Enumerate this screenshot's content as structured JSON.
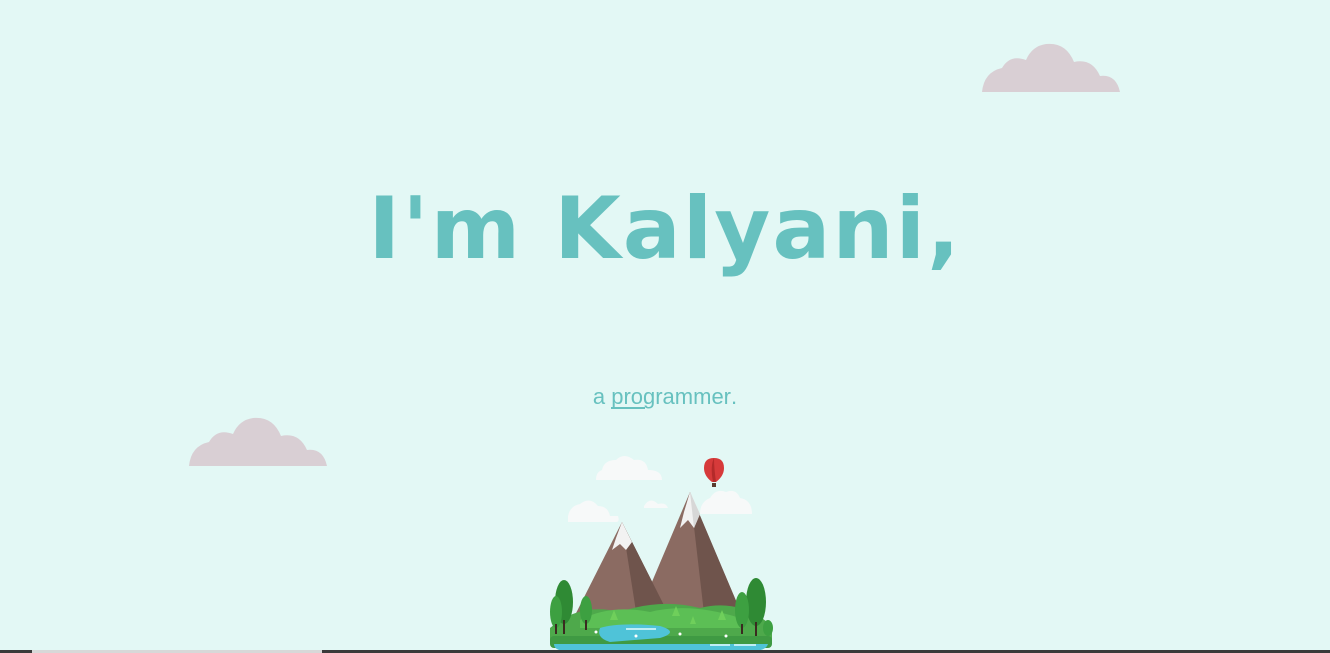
{
  "hero": {
    "title": "I'm Kalyani,",
    "subtitle_prefix": "a ",
    "subtitle_word": "programmer",
    "subtitle_suffix": "."
  },
  "illustration": {
    "name": "mountain-island-with-hot-air-balloon",
    "icons": [
      "cloud-icon",
      "hot-air-balloon-icon",
      "mountain-icon",
      "tree-icon"
    ]
  },
  "colors": {
    "background": "#e3f8f5",
    "accent": "#67c1bf",
    "cloud": "#d9cfd4",
    "mountain": "#8b6b62",
    "grass": "#4ea94b",
    "water": "#4fc3d8",
    "balloon": "#d63a3a"
  }
}
